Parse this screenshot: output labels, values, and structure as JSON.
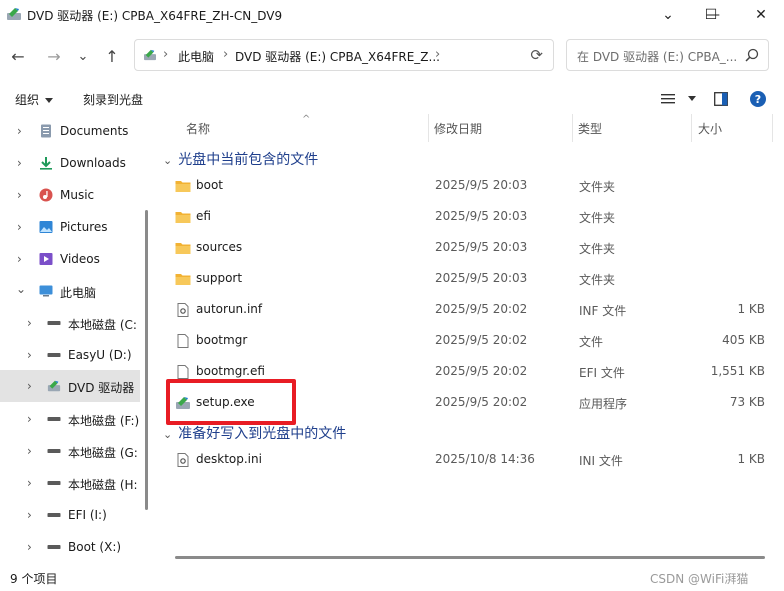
{
  "window": {
    "title": "DVD 驱动器 (E:) CPBA_X64FRE_ZH-CN_DV9",
    "minimize": "—",
    "maximize": "☐",
    "close": "✕",
    "overflow": "⌄"
  },
  "navbar": {
    "back": "←",
    "forward": "→",
    "recent": "⌄",
    "up": "↑",
    "crumb_sep": "›",
    "crumbs": [
      "此电脑",
      "DVD 驱动器 (E:) CPBA_X64FRE_Z..."
    ],
    "refresh": "⟳",
    "search_placeholder": "在 DVD 驱动器 (E:) CPBA_..."
  },
  "command_bar": {
    "organize": "组织",
    "burn": "刻录到光盘"
  },
  "sidebar": {
    "items": [
      {
        "label": "Documents",
        "icon": "documents-icon"
      },
      {
        "label": "Downloads",
        "icon": "downloads-icon"
      },
      {
        "label": "Music",
        "icon": "music-icon"
      },
      {
        "label": "Pictures",
        "icon": "pictures-icon"
      },
      {
        "label": "Videos",
        "icon": "videos-icon"
      },
      {
        "label": "此电脑",
        "icon": "this-pc-icon"
      },
      {
        "label": "本地磁盘 (C:",
        "icon": "drive-icon"
      },
      {
        "label": "EasyU (D:)",
        "icon": "drive-icon"
      },
      {
        "label": "DVD 驱动器",
        "icon": "dvd-icon"
      },
      {
        "label": "本地磁盘 (F:)",
        "icon": "drive-icon"
      },
      {
        "label": "本地磁盘 (G:",
        "icon": "drive-icon"
      },
      {
        "label": "本地磁盘 (H:",
        "icon": "drive-icon"
      },
      {
        "label": "EFI (I:)",
        "icon": "drive-icon"
      },
      {
        "label": "Boot (X:)",
        "icon": "drive-icon"
      }
    ],
    "chevron_collapsed": "›",
    "chevron_expanded": "⌄"
  },
  "columns": {
    "name": "名称",
    "modified": "修改日期",
    "type": "类型",
    "size": "大小"
  },
  "groups": [
    {
      "title": "光盘中当前包含的文件",
      "files": [
        {
          "name": "boot",
          "date": "2025/9/5 20:03",
          "type": "文件夹",
          "size": "",
          "icon": "folder-icon"
        },
        {
          "name": "efi",
          "date": "2025/9/5 20:03",
          "type": "文件夹",
          "size": "",
          "icon": "folder-icon"
        },
        {
          "name": "sources",
          "date": "2025/9/5 20:03",
          "type": "文件夹",
          "size": "",
          "icon": "folder-icon"
        },
        {
          "name": "support",
          "date": "2025/9/5 20:03",
          "type": "文件夹",
          "size": "",
          "icon": "folder-icon"
        },
        {
          "name": "autorun.inf",
          "date": "2025/9/5 20:02",
          "type": "INF 文件",
          "size": "1 KB",
          "icon": "settings-file-icon"
        },
        {
          "name": "bootmgr",
          "date": "2025/9/5 20:02",
          "type": "文件",
          "size": "405 KB",
          "icon": "file-icon"
        },
        {
          "name": "bootmgr.efi",
          "date": "2025/9/5 20:02",
          "type": "EFI 文件",
          "size": "1,551 KB",
          "icon": "file-icon"
        },
        {
          "name": "setup.exe",
          "date": "2025/9/5 20:02",
          "type": "应用程序",
          "size": "73 KB",
          "icon": "setup-app-icon"
        }
      ]
    },
    {
      "title": "准备好写入到光盘中的文件",
      "files": [
        {
          "name": "desktop.ini",
          "date": "2025/10/8 14:36",
          "type": "INI 文件",
          "size": "1 KB",
          "icon": "settings-file-icon"
        }
      ]
    }
  ],
  "status": {
    "count": "9 个项目"
  },
  "watermark": "CSDN @WiFi湃猫",
  "colors": {
    "group_title": "#1f3f8c",
    "highlight": "#e81c24",
    "selection": "#e3e3e3",
    "folder": "#f2b233"
  }
}
